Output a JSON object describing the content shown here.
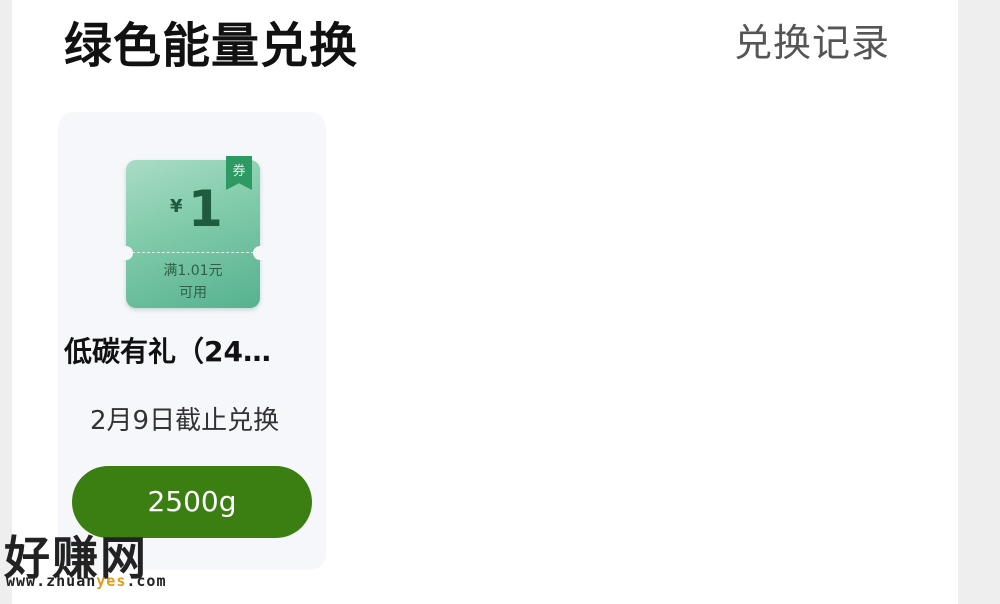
{
  "header": {
    "title": "绿色能量兑换",
    "records_link": "兑换记录"
  },
  "items": [
    {
      "coupon": {
        "currency_symbol": "¥",
        "amount": "1",
        "condition_line1": "满1.01元",
        "condition_line2": "可用",
        "badge": "券",
        "color": "#7fcaa9"
      },
      "name": "低碳有礼（24…",
      "deadline": "2月9日截止兑换",
      "cost_label": "2500g",
      "button_color": "#3b7f12"
    }
  ],
  "watermark": {
    "text": "好赚网",
    "url_prefix": "www.zhuan",
    "url_highlight": "yes",
    "url_suffix": ".com"
  }
}
